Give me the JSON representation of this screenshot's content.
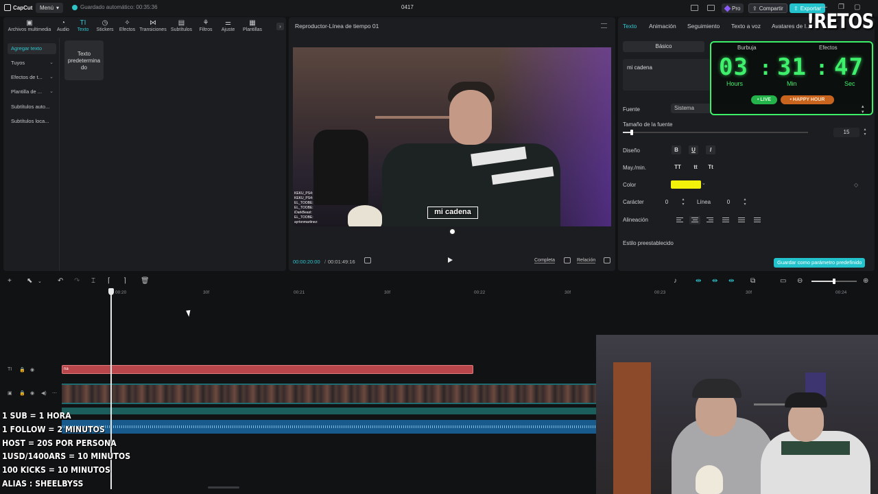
{
  "app": {
    "logo_text": "CapCut",
    "menu_label": "Menú",
    "autosave_text": "Guardado automático: 00:35:36",
    "project_title": "0417",
    "pro_label": "Pro",
    "share_label": "Compartir",
    "export_label": "Exportar"
  },
  "toolbar": {
    "items": [
      {
        "label": "Archivos multimedia",
        "icon": "media-icon"
      },
      {
        "label": "Audio",
        "icon": "audio-icon"
      },
      {
        "label": "Texto",
        "icon": "text-icon",
        "active": true
      },
      {
        "label": "Stickers",
        "icon": "sticker-icon"
      },
      {
        "label": "Efectos",
        "icon": "effects-icon"
      },
      {
        "label": "Transiciones",
        "icon": "transitions-icon"
      },
      {
        "label": "Subtítulos",
        "icon": "subtitles-icon"
      },
      {
        "label": "Filtros",
        "icon": "filters-icon"
      },
      {
        "label": "Ajuste",
        "icon": "adjust-icon"
      },
      {
        "label": "Plantillas",
        "icon": "templates-icon"
      }
    ]
  },
  "side_nav": {
    "items": [
      {
        "label": "Agregar texto",
        "active": true
      },
      {
        "label": "Tuyos",
        "chevron": true
      },
      {
        "label": "Efectos de t...",
        "chevron": true
      },
      {
        "label": "Plantilla de ...",
        "chevron": true
      },
      {
        "label": "Subtítulos auto..."
      },
      {
        "label": "Subtítulos loca..."
      }
    ],
    "card_label": "Texto predetermina do"
  },
  "player": {
    "title": "Reproductor-Línea de tiempo 01",
    "caption": "mi cadena",
    "chat_lines": [
      "KEKU_PS4:",
      "KEKU_PS4:",
      "EL_TOOBE:",
      "EL_TOOBE:",
      "iDarkBeast:",
      "EL_TOOBE:",
      "ayrtonmartinez:"
    ],
    "time_current": "00:00:20:00",
    "time_total": "00:01:49:16",
    "btn_full": "Completa",
    "btn_ratio": "Relación"
  },
  "inspector": {
    "tabs": [
      "Texto",
      "Animación",
      "Seguimiento",
      "Texto a voz",
      "Avatares de I..."
    ],
    "seg_basic": "Básico",
    "text_value": "mi cadena",
    "font_label": "Fuente",
    "font_value": "Sistema",
    "font_size_label": "Tamaño de la fuente",
    "font_size_value": "15",
    "design_label": "Diseño",
    "case_label": "May./min.",
    "color_label": "Color",
    "color_value": "#f2f20a",
    "char_label": "Carácter",
    "char_value": "0",
    "line_label": "Línea",
    "line_value": "0",
    "align_label": "Alineación",
    "preset_label": "Estilo preestablecido",
    "save_preset": "Guardar como parámetro predefinido",
    "format_buttons": [
      "B",
      "U",
      "I"
    ],
    "case_buttons": [
      "TT",
      "tt",
      "Tt"
    ]
  },
  "timer": {
    "tab_left": "Burbuja",
    "tab_right": "Efectos",
    "hours": "03",
    "minutes": "31",
    "seconds": "47",
    "hours_label": "Hours",
    "minutes_label": "Min",
    "seconds_label": "Sec",
    "live_label": "• LIVE",
    "happy_label": "• HAPPY HOUR",
    "accent": "#3ef06b"
  },
  "retos": "!RETOS",
  "timeline": {
    "ticks": [
      "00:20",
      "30f",
      "00:21",
      "30f",
      "00:22",
      "30f",
      "00:23",
      "30f",
      "00:24"
    ],
    "text_clip_label": "na"
  },
  "rules": [
    "1 SUB = 1 HORA",
    "1 FOLLOW = 2 MINUTOS",
    "HOST = 20S POR PERSONA",
    "1USD/1400ARS = 10 MINUTOS",
    "100 KICKS = 10 MINUTOS",
    "ALIAS : SHEELBYSS"
  ]
}
